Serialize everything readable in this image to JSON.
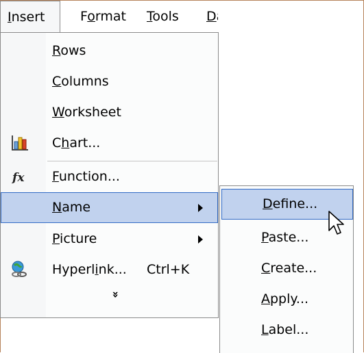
{
  "menubar": {
    "insert": {
      "u": "I",
      "rest": "nsert"
    },
    "format": {
      "a": "F",
      "u": "o",
      "rest": "rmat"
    },
    "tools": {
      "u": "T",
      "rest": "ools"
    },
    "data": {
      "u": "D",
      "rest": "a"
    }
  },
  "insert_menu": {
    "rows": {
      "u": "R",
      "rest": "ows"
    },
    "columns": {
      "u": "C",
      "rest": "olumns"
    },
    "worksheet": {
      "u": "W",
      "rest": "orksheet"
    },
    "chart": {
      "a": "C",
      "u": "h",
      "rest": "art..."
    },
    "function": {
      "u": "F",
      "rest": "unction..."
    },
    "name": {
      "u": "N",
      "rest": "ame"
    },
    "picture": {
      "u": "P",
      "rest": "icture"
    },
    "hyperlink": {
      "a": "Hyperl",
      "u": "i",
      "rest": "nk...",
      "shortcut": "Ctrl+K"
    },
    "more": "»"
  },
  "name_submenu": {
    "define": {
      "u": "D",
      "rest": "efine..."
    },
    "paste": {
      "u": "P",
      "rest": "aste..."
    },
    "create": {
      "u": "C",
      "rest": "reate..."
    },
    "apply": {
      "u": "A",
      "rest": "pply..."
    },
    "label": {
      "u": "L",
      "rest": "abel..."
    }
  },
  "colors": {
    "highlight": "#c1d2ee",
    "highlight_border": "#316ac5",
    "gutter": "#f6f7f8"
  }
}
